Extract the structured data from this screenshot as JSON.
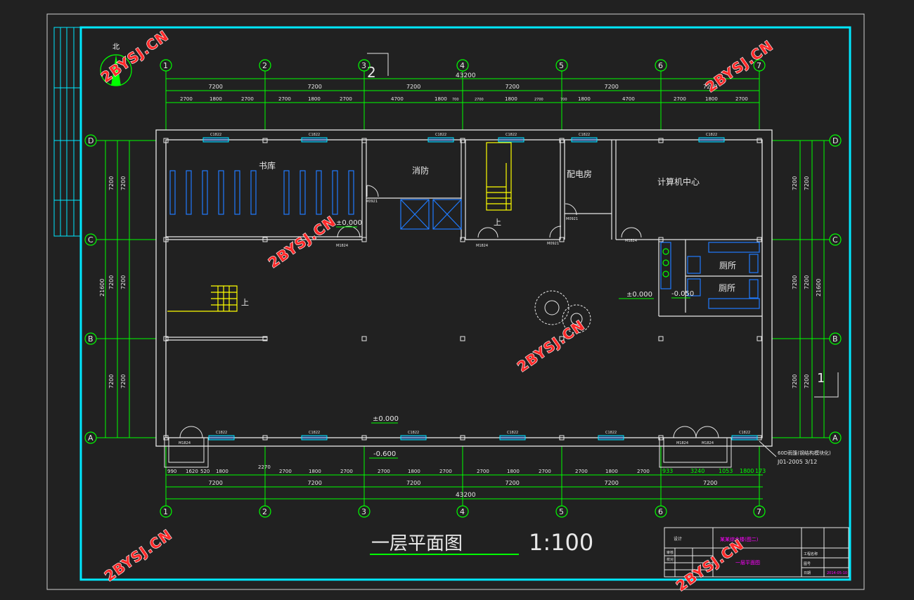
{
  "drawing": {
    "title": "一层平面图",
    "scale": "1:100",
    "north_label": "北",
    "total_dim": "43200",
    "span_dim": "7200",
    "side_total": "21600"
  },
  "grid": {
    "columns": [
      "1",
      "2",
      "3",
      "4",
      "5",
      "6",
      "7"
    ],
    "rows": [
      "D",
      "C",
      "B",
      "A"
    ]
  },
  "top_dims": [
    "2700",
    "1800",
    "2700",
    "2700",
    "1800",
    "2700",
    "4700",
    "1800",
    "700",
    "2700",
    "1800",
    "2700",
    "700",
    "1800",
    "4700",
    "2700",
    "1800",
    "2700"
  ],
  "bottom_dims": [
    "990",
    "1620",
    "520",
    "1800",
    "2270",
    "2700",
    "1800",
    "2700",
    "2700",
    "1800",
    "2700",
    "2700",
    "1800",
    "2700",
    "2700",
    "1800",
    "2700"
  ],
  "bottom_green_dims": [
    "933",
    "3240",
    "1053",
    "1800",
    "173"
  ],
  "rooms": {
    "library": "书库",
    "fire": "消防",
    "power": "配电房",
    "computer": "计算机中心",
    "toilet1": "厕所",
    "toilet2": "厕所"
  },
  "labels": {
    "up": "上",
    "elev_zero": "±0.000",
    "elev_neg600": "-0.600",
    "elev_neg050": "-0.050",
    "window": "C1822",
    "door_m1824": "M1824",
    "door_m0921": "M0921",
    "note1": "60D雨篷(钢结构模块化)",
    "note2": "J01-2005 3/12",
    "mark1": "2",
    "mark2": "1"
  },
  "title_block": {
    "project": "某某综合楼(图二)",
    "sheet": "一层平面图",
    "cells": [
      "设计",
      "审核",
      "校对",
      "工程名称",
      "图号",
      "日期",
      "2014-05-10"
    ]
  },
  "watermark": "2BYSJ.CN",
  "colors": {
    "frame": "#00ffff",
    "wall": "#e8e8e8",
    "dim": "#00ff00",
    "stair": "#ffff00",
    "fixture": "#1f7bff",
    "magenta": "#ff00ff",
    "watermark": "#ff2a2a"
  }
}
